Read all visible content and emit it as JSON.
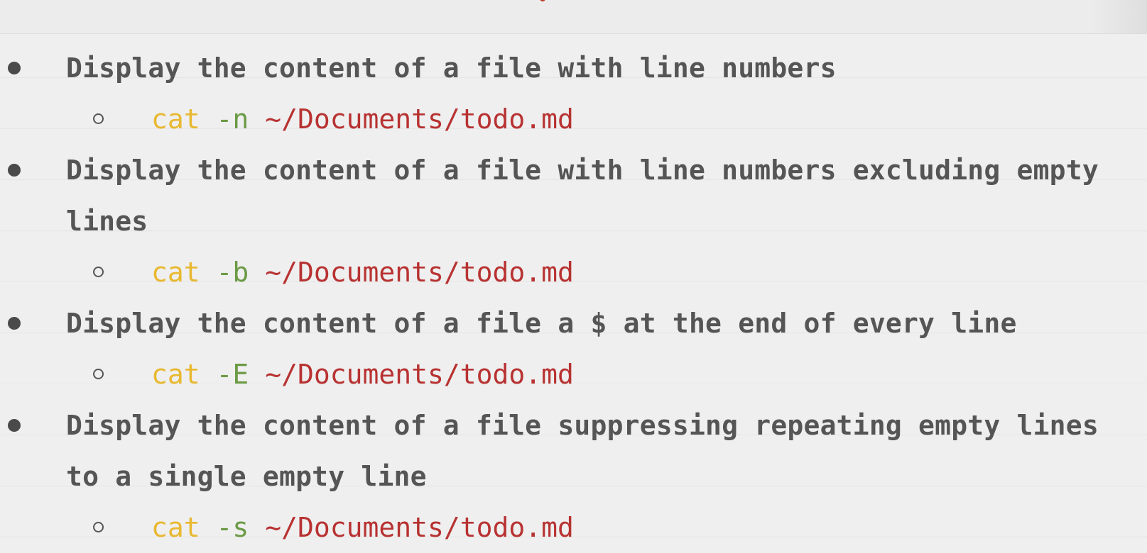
{
  "items": [
    {
      "description": "Display the content of a file with line numbers",
      "command": {
        "name": "cat",
        "flag": "-n",
        "path": "~/Documents/todo.md"
      }
    },
    {
      "description": "Display the content of a file with line numbers excluding empty lines",
      "command": {
        "name": "cat",
        "flag": "-b",
        "path": "~/Documents/todo.md"
      }
    },
    {
      "description": "Display the content of a file a $ at the end of every line",
      "command": {
        "name": "cat",
        "flag": "-E",
        "path": "~/Documents/todo.md"
      }
    },
    {
      "description": "Display the content of a file suppressing repeating empty lines to a single empty line",
      "command": {
        "name": "cat",
        "flag": "-s",
        "path": "~/Documents/todo.md"
      }
    }
  ],
  "colors": {
    "background": "#efefef",
    "text": "#555555",
    "command_name": "#e8b830",
    "command_flag": "#6b9a45",
    "command_path": "#b83232"
  }
}
